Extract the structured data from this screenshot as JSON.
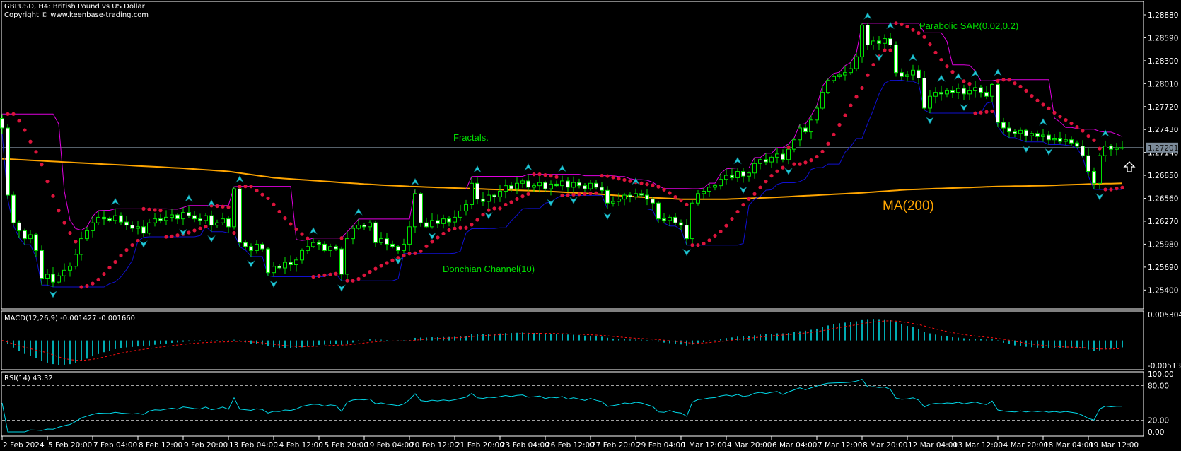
{
  "header": {
    "title": "GBPUSD, H4:  British Pound vs US Dollar",
    "copyright": "Copyright © www.keenbase-trading.com"
  },
  "labels": {
    "fractals": "Fractals.",
    "sar": "Parabolic SAR(0.02,0.2)",
    "donchian": "Donchian Channel(10)",
    "ma": "MA(200)",
    "macd": "MACD(12,26,9) -0.001427 -0.001660",
    "rsi": "RSI(14) 43.32"
  },
  "colors": {
    "background": "#000000",
    "candle_wick": "#00e000",
    "bear_body": "#ffffff",
    "bull_body": "#000000",
    "donchian_upper": "#e000e0",
    "donchian_lower": "#1010d0",
    "sar": "#dc143c",
    "ma": "#ffa500",
    "fractal": "#20c8d8",
    "macd_hist": "#00e5ee",
    "macd_signal": "#ff1010",
    "rsi": "#00d8e8",
    "price_line": "#8899aa",
    "text_green": "#00e000"
  },
  "chart_data": {
    "type": "candlestick",
    "symbol": "GBPUSD",
    "timeframe": "H4",
    "current_price": "1.27201",
    "y_ticks": [
      "1.28880",
      "1.28590",
      "1.28300",
      "1.28010",
      "1.27720",
      "1.27430",
      "1.27140",
      "1.26850",
      "1.26560",
      "1.26270",
      "1.25980",
      "1.25690",
      "1.25400"
    ],
    "ylim": [
      1.2513,
      1.2906
    ],
    "x_ticks": [
      "2 Feb 2024",
      "5 Feb 20:00",
      "7 Feb 04:00",
      "8 Feb 12:00",
      "9 Feb 20:00",
      "13 Feb 04:00",
      "14 Feb 12:00",
      "15 Feb 20:00",
      "19 Feb 04:00",
      "20 Feb 12:00",
      "21 Feb 20:00",
      "23 Feb 04:00",
      "26 Feb 12:00",
      "27 Feb 20:00",
      "29 Feb 04:00",
      "1 Mar 12:00",
      "4 Mar 20:00",
      "6 Mar 04:00",
      "7 Mar 12:00",
      "8 Mar 20:00",
      "12 Mar 04:00",
      "13 Mar 12:00",
      "14 Mar 20:00",
      "18 Mar 04:00",
      "19 Mar 12:00"
    ],
    "closes": [
      1.2745,
      1.266,
      1.2625,
      1.2615,
      1.2605,
      1.261,
      1.259,
      1.2555,
      1.256,
      1.255,
      1.2558,
      1.2565,
      1.257,
      1.2585,
      1.2605,
      1.2615,
      1.2625,
      1.2632,
      1.263,
      1.2628,
      1.2634,
      1.2626,
      1.2622,
      1.2618,
      1.262,
      1.2612,
      1.2625,
      1.263,
      1.2628,
      1.2632,
      1.2635,
      1.263,
      1.2638,
      1.2634,
      1.263,
      1.2628,
      1.2634,
      1.2622,
      1.2625,
      1.263,
      1.262,
      1.2668,
      1.26,
      1.2595,
      1.259,
      1.2598,
      1.2592,
      1.2562,
      1.257,
      1.2568,
      1.2575,
      1.2572,
      1.2578,
      1.259,
      1.2595,
      1.26,
      1.2598,
      1.259,
      1.2595,
      1.2592,
      1.256,
      1.2605,
      1.2618,
      1.2622,
      1.262,
      1.2625,
      1.26,
      1.2605,
      1.2598,
      1.2595,
      1.259,
      1.2598,
      1.262,
      1.2662,
      1.2625,
      1.262,
      1.2628,
      1.2624,
      1.263,
      1.2626,
      1.2632,
      1.264,
      1.2648,
      1.2675,
      1.2655,
      1.2652,
      1.266,
      1.2658,
      1.2665,
      1.2672,
      1.2668,
      1.2675,
      1.2678,
      1.267,
      1.2672,
      1.2676,
      1.2668,
      1.2674,
      1.2672,
      1.2678,
      1.267,
      1.2676,
      1.2672,
      1.2668,
      1.2675,
      1.267,
      1.2666,
      1.265,
      1.2652,
      1.2655,
      1.266,
      1.2658,
      1.2662,
      1.266,
      1.2655,
      1.265,
      1.263,
      1.2628,
      1.2632,
      1.2625,
      1.2622,
      1.2605,
      1.265,
      1.2662,
      1.2665,
      1.267,
      1.2672,
      1.268,
      1.2685,
      1.2682,
      1.269,
      1.2684,
      1.2688,
      1.27,
      1.2705,
      1.2702,
      1.2708,
      1.2712,
      1.2705,
      1.2718,
      1.273,
      1.2745,
      1.274,
      1.2755,
      1.277,
      1.279,
      1.2805,
      1.281,
      1.2812,
      1.2815,
      1.282,
      1.2835,
      1.2875,
      1.285,
      1.2855,
      1.2852,
      1.2858,
      1.285,
      1.2815,
      1.281,
      1.2812,
      1.2818,
      1.2808,
      1.277,
      1.2785,
      1.279,
      1.2788,
      1.2792,
      1.279,
      1.2795,
      1.2788,
      1.2792,
      1.2796,
      1.279,
      1.2785,
      1.28,
      1.2752,
      1.2745,
      1.274,
      1.2738,
      1.2742,
      1.2735,
      1.2738,
      1.2734,
      1.2736,
      1.273,
      1.2732,
      1.2728,
      1.273,
      1.2726,
      1.2722,
      1.271,
      1.269,
      1.2675,
      1.271,
      1.2722,
      1.2718,
      1.272,
      1.27201
    ],
    "ma200": [
      1.2706,
      1.2703,
      1.27,
      1.2697,
      1.2694,
      1.269,
      1.2682,
      1.2678,
      1.2674,
      1.2671,
      1.2669,
      1.2667,
      1.2665,
      1.2662,
      1.2658,
      1.2655,
      1.2655,
      1.2657,
      1.266,
      1.2663,
      1.2667,
      1.2669,
      1.2671,
      1.2672,
      1.2674,
      1.2675
    ],
    "macd": {
      "params": "12,26,9",
      "main": -0.001427,
      "signal": -0.00166,
      "ylim": [
        -0.005133,
        0.005304
      ],
      "y_ticks": [
        "0.005304",
        "-0.005133"
      ]
    },
    "rsi": {
      "period": 14,
      "value": 43.32,
      "ylim": [
        0,
        100
      ],
      "levels": [
        20,
        80
      ],
      "y_ticks": [
        "100.00",
        "80.00",
        "20.00",
        "0.00"
      ]
    },
    "grid": false
  }
}
